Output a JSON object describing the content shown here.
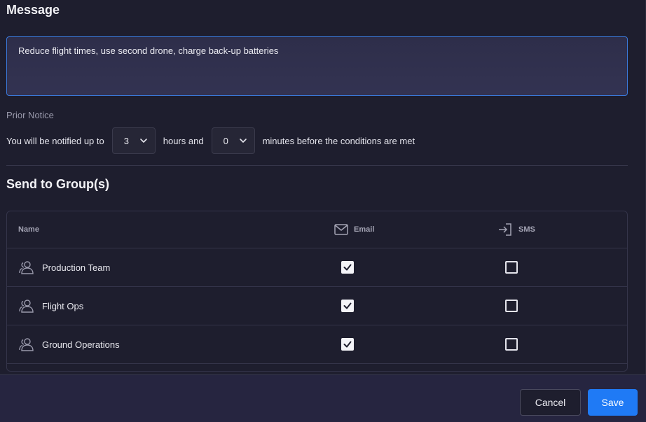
{
  "message": {
    "title": "Message",
    "value": "Reduce flight times, use second drone, charge back-up batteries"
  },
  "prior_notice": {
    "label": "Prior Notice",
    "text_before": "You will be notified up to",
    "hours_value": "3",
    "text_middle": "hours and",
    "minutes_value": "0",
    "text_after": "minutes before the conditions are met"
  },
  "groups": {
    "title": "Send to Group(s)",
    "columns": {
      "name": "Name",
      "email": "Email",
      "sms": "SMS"
    },
    "rows": [
      {
        "name": "Production Team",
        "email": true,
        "sms": false
      },
      {
        "name": "Flight Ops",
        "email": true,
        "sms": false
      },
      {
        "name": "Ground Operations",
        "email": true,
        "sms": false
      }
    ]
  },
  "footer": {
    "cancel_label": "Cancel",
    "save_label": "Save"
  },
  "icons": {
    "email_header": "mail-icon",
    "sms_header": "sign-in-icon",
    "group_row": "users-icon",
    "dropdown": "chevron-down-icon"
  },
  "colors": {
    "accent": "#1f7af5",
    "focus_border": "#3a78d8",
    "background": "#1e1e2e"
  }
}
